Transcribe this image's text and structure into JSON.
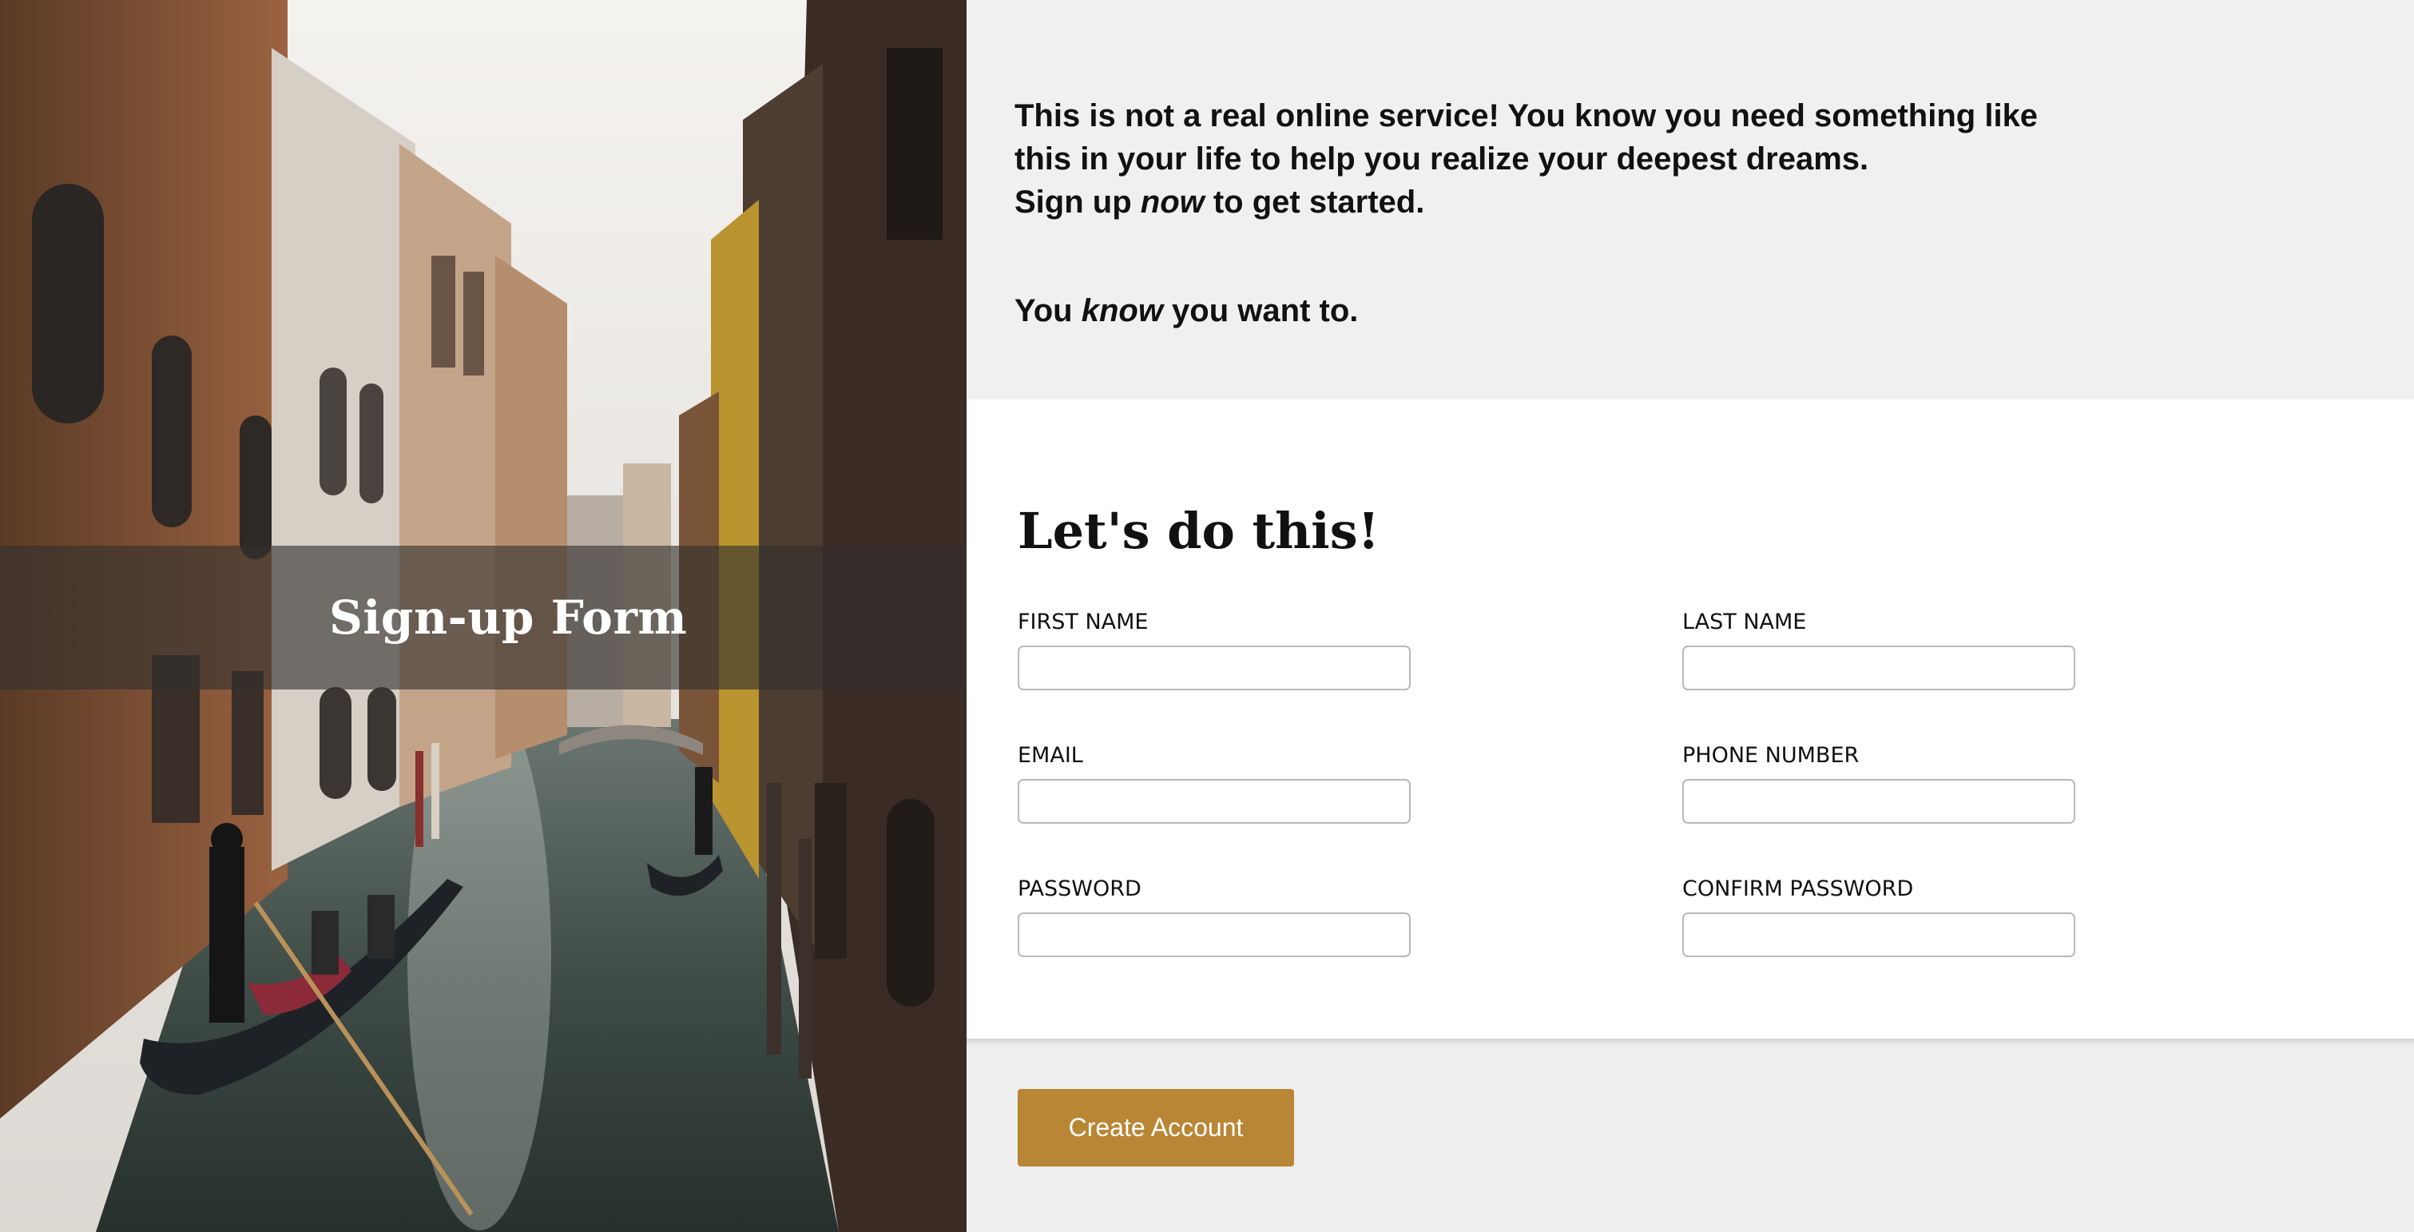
{
  "hero": {
    "title": "Sign-up Form"
  },
  "intro": {
    "line1": "This is not a real online service! You know you need something like this in your life to help you realize your deepest dreams.",
    "line2_before": "Sign up ",
    "line2_em": "now",
    "line2_after": " to get started.",
    "line3_before": "You ",
    "line3_em": "know",
    "line3_after": " you want to."
  },
  "form": {
    "heading": "Let's do this!",
    "fields": {
      "first_name": {
        "label": "FIRST NAME",
        "value": ""
      },
      "last_name": {
        "label": "LAST NAME",
        "value": ""
      },
      "email": {
        "label": "EMAIL",
        "value": ""
      },
      "phone": {
        "label": "PHONE NUMBER",
        "value": ""
      },
      "password": {
        "label": "PASSWORD",
        "value": ""
      },
      "confirm_password": {
        "label": "CONFIRM PASSWORD",
        "value": ""
      }
    }
  },
  "actions": {
    "create_label": "Create Account"
  },
  "colors": {
    "button": "#b98635",
    "intro_bg": "#f0f0f0",
    "form_bg": "#ffffff"
  }
}
